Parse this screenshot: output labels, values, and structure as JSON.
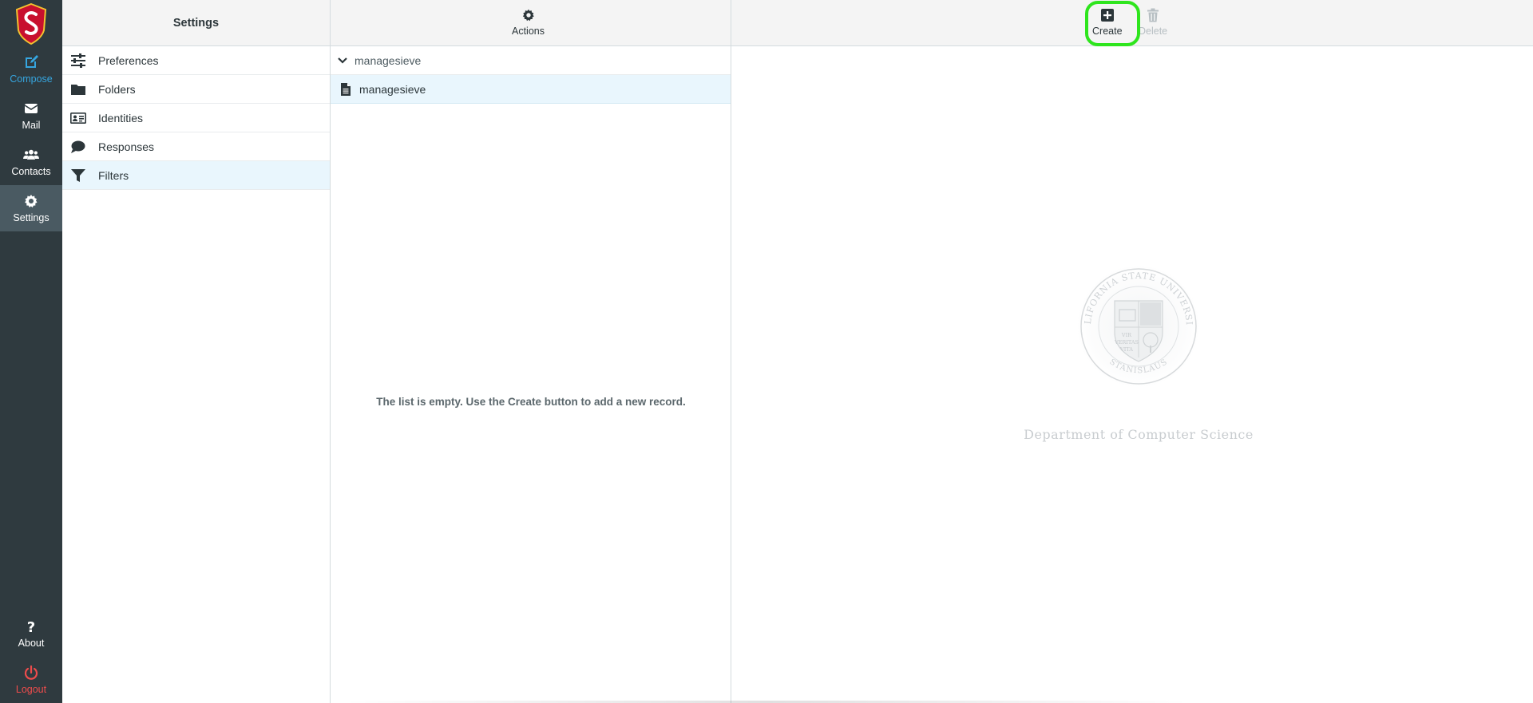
{
  "rail": {
    "items": [
      {
        "label": "Compose",
        "icon": "compose-icon"
      },
      {
        "label": "Mail",
        "icon": "mail-icon"
      },
      {
        "label": "Contacts",
        "icon": "contacts-icon"
      },
      {
        "label": "Settings",
        "icon": "gear-icon"
      },
      {
        "label": "About",
        "icon": "question-icon"
      },
      {
        "label": "Logout",
        "icon": "power-icon"
      }
    ]
  },
  "settings_panel": {
    "title": "Settings",
    "items": [
      {
        "label": "Preferences",
        "icon": "sliders-icon"
      },
      {
        "label": "Folders",
        "icon": "folder-icon"
      },
      {
        "label": "Identities",
        "icon": "id-card-icon"
      },
      {
        "label": "Responses",
        "icon": "comment-icon"
      },
      {
        "label": "Filters",
        "icon": "filter-icon",
        "active": true
      }
    ]
  },
  "filter_sets": {
    "actions_label": "Actions",
    "group_label": "managesieve",
    "selected_set": "managesieve",
    "empty_message": "The list is empty. Use the Create button to add a new record."
  },
  "content": {
    "create_label": "Create",
    "delete_label": "Delete",
    "department": "Department of Computer Science",
    "seal_top_text": "CALIFORNIA STATE UNIVERSITY",
    "seal_bottom_text": "STANISLAUS",
    "seal_motto": [
      "VIR",
      "VERITAS",
      "VITA"
    ]
  },
  "colors": {
    "rail_bg": "#2f3a3f",
    "accent_blue": "#36a6e0",
    "logout_red": "#ef4c4c",
    "selection_bg": "#e9f6fd",
    "highlight_ring": "#2ee51d"
  }
}
